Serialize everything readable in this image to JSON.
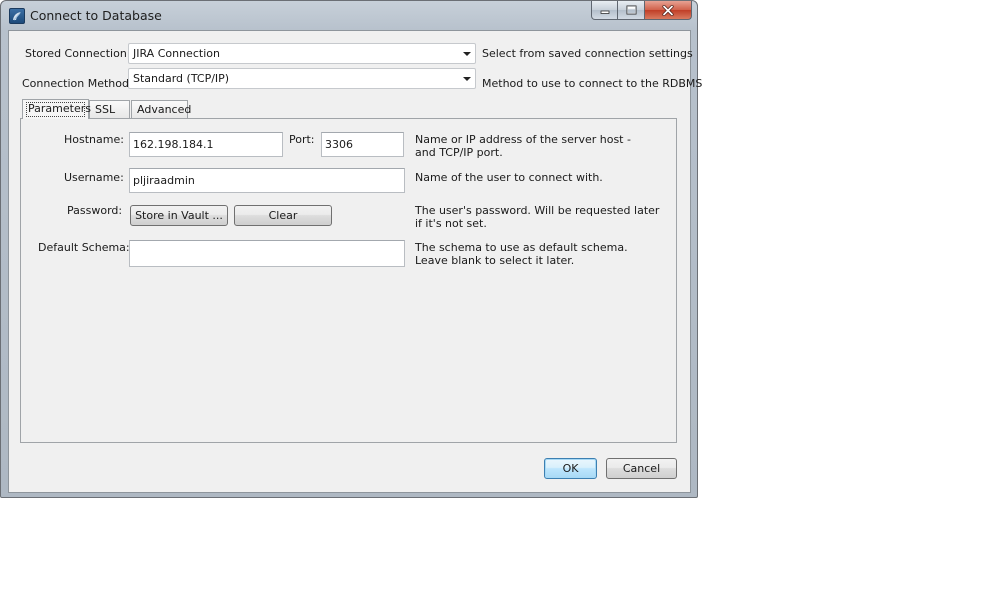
{
  "window": {
    "title": "Connect to Database",
    "buttons": {
      "minimize": "minimize",
      "maximize": "maximize",
      "close": "close"
    }
  },
  "stored_connection": {
    "label": "Stored Connection:",
    "value": "JIRA Connection",
    "help": "Select from saved connection settings"
  },
  "connection_method": {
    "label": "Connection Method:",
    "value": "Standard (TCP/IP)",
    "help": "Method to use to connect to the RDBMS"
  },
  "tabs": [
    {
      "label": "Parameters",
      "active": true
    },
    {
      "label": "SSL",
      "active": false
    },
    {
      "label": "Advanced",
      "active": false
    }
  ],
  "params": {
    "hostname": {
      "label": "Hostname:",
      "value": "162.198.184.1",
      "help": "Name or IP address of the server host - and TCP/IP port."
    },
    "port": {
      "label": "Port:",
      "value": "3306"
    },
    "username": {
      "label": "Username:",
      "value": "pljiraadmin",
      "help": "Name of the user to connect with."
    },
    "password": {
      "label": "Password:",
      "store_button": "Store in Vault ...",
      "clear_button": "Clear",
      "help": "The user's password. Will be requested later if it's not set."
    },
    "default_schema": {
      "label": "Default Schema:",
      "value": "",
      "help": "The schema to use as default schema. Leave blank to select it later."
    }
  },
  "footer": {
    "ok": "OK",
    "cancel": "Cancel"
  },
  "colors": {
    "accent": "#3c7fb1",
    "close_button": "#c03e27",
    "dialog_bg": "#f0f0f0"
  }
}
